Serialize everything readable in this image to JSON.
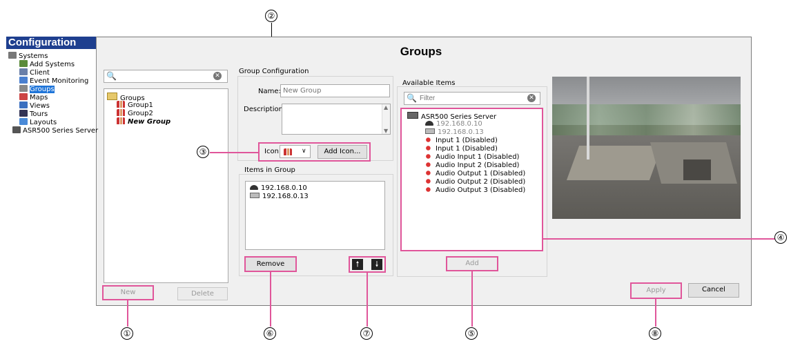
{
  "callouts": [
    "①",
    "②",
    "③",
    "④",
    "⑤",
    "⑥",
    "⑦",
    "⑧"
  ],
  "sidebar": {
    "title": "Configuration",
    "items": [
      {
        "label": "Systems",
        "icon": "systems-icon"
      },
      {
        "label": "Add Systems",
        "icon": "add-systems-icon"
      },
      {
        "label": "Client",
        "icon": "client-icon"
      },
      {
        "label": "Event Monitoring",
        "icon": "event-monitoring-icon"
      },
      {
        "label": "Groups",
        "icon": "groups-icon",
        "selected": true
      },
      {
        "label": "Maps",
        "icon": "maps-icon"
      },
      {
        "label": "Views",
        "icon": "views-icon"
      },
      {
        "label": "Tours",
        "icon": "tours-icon"
      },
      {
        "label": "Layouts",
        "icon": "layouts-icon"
      },
      {
        "label": "ASR500 Series Server",
        "icon": "server-icon"
      }
    ]
  },
  "header": {
    "title": "Groups"
  },
  "group_list": {
    "search_value": "",
    "root": "Groups",
    "items": [
      "Group1",
      "Group2",
      "New Group"
    ],
    "new_label": "New",
    "delete_label": "Delete"
  },
  "group_config": {
    "section_label": "Group Configuration",
    "name_label": "Name:",
    "name_placeholder": "New Group",
    "description_label": "Description:",
    "icon_label": "Icon:",
    "add_icon_label": "Add Icon..."
  },
  "items_in_group": {
    "section_label": "Items in Group",
    "items": [
      "192.168.0.10",
      "192.168.0.13"
    ],
    "remove_label": "Remove"
  },
  "available_items": {
    "section_label": "Available Items",
    "filter_placeholder": "Filter",
    "server": "ASR500 Series Server",
    "items": [
      {
        "label": "192.168.0.10",
        "icon": "camera-icon",
        "gray": true
      },
      {
        "label": "192.168.0.13",
        "icon": "encoder-icon",
        "gray": true
      },
      {
        "label": "Input 1 (Disabled)",
        "icon": "io-icon"
      },
      {
        "label": "Input 1 (Disabled)",
        "icon": "io-icon"
      },
      {
        "label": "Audio Input 1 (Disabled)",
        "icon": "io-icon"
      },
      {
        "label": "Audio Input 2 (Disabled)",
        "icon": "io-icon"
      },
      {
        "label": "Audio Output 1 (Disabled)",
        "icon": "io-icon"
      },
      {
        "label": "Audio Output 2 (Disabled)",
        "icon": "io-icon"
      },
      {
        "label": "Audio Output 3 (Disabled)",
        "icon": "io-icon"
      }
    ],
    "add_label": "Add"
  },
  "footer": {
    "apply_label": "Apply",
    "cancel_label": "Cancel"
  },
  "colors": {
    "accent": "#e0559a",
    "title_bar": "#1e3f8f",
    "selection": "#1e74d8"
  }
}
